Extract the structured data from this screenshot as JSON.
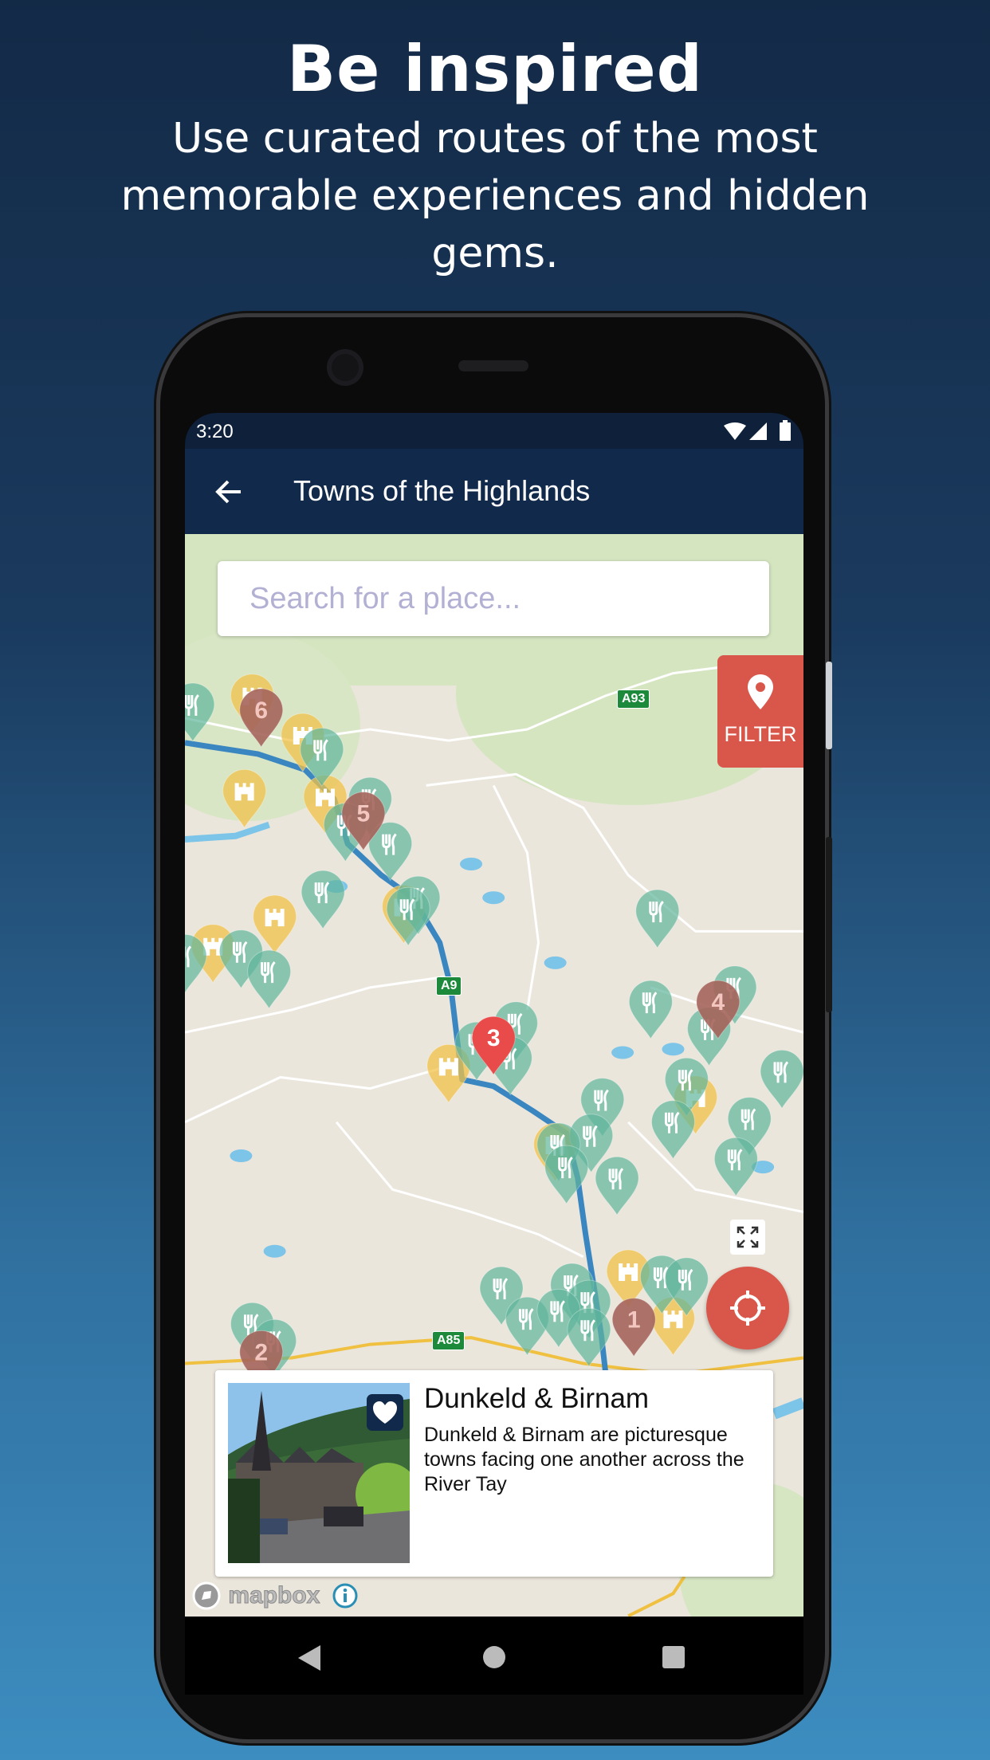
{
  "promo": {
    "headline": "Be inspired",
    "subline": "Use curated routes of the most memorable experiences and hidden gems."
  },
  "status_bar": {
    "time": "3:20",
    "icons": [
      "wifi-icon",
      "signal-icon",
      "battery-icon"
    ]
  },
  "app_bar": {
    "back_icon": "arrow-left-icon",
    "title": "Towns of the Highlands"
  },
  "map": {
    "search_placeholder": "Search for a place...",
    "search_value": "",
    "filter_label": "FILTER",
    "road_labels": [
      "A93",
      "A9",
      "A85"
    ],
    "route_stops": [
      "1",
      "2",
      "3",
      "4",
      "5",
      "6"
    ],
    "selected_stop": "3",
    "attribution": "mapbox",
    "colors": {
      "route": "#3a86c0",
      "stop": "#a5655c",
      "selected_stop": "#e94b4b",
      "restaurant": "#5fb59b",
      "attraction": "#f2c14a",
      "accent": "#d9574a",
      "water": "#7cc4e8"
    }
  },
  "place_card": {
    "title": "Dunkeld & Birnam",
    "description": "Dunkeld & Birnam are picturesque towns facing one another across the River Tay",
    "favorite_icon": "heart-icon"
  },
  "nav_bar": {
    "buttons": [
      "back-icon",
      "home-icon",
      "recents-icon"
    ]
  }
}
